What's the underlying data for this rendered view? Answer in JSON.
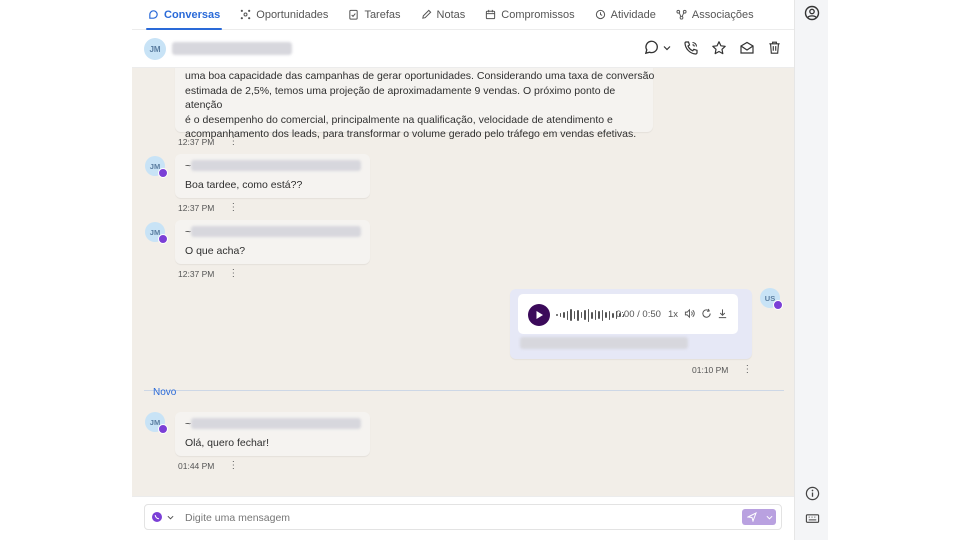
{
  "tabs": [
    {
      "label": "Conversas",
      "icon": "chat-icon",
      "active": true
    },
    {
      "label": "Oportunidades",
      "icon": "network-icon",
      "active": false
    },
    {
      "label": "Tarefas",
      "icon": "clipboard-check-icon",
      "active": false
    },
    {
      "label": "Notas",
      "icon": "pencil-icon",
      "active": false
    },
    {
      "label": "Compromissos",
      "icon": "calendar-icon",
      "active": false
    },
    {
      "label": "Atividade",
      "icon": "clock-icon",
      "active": false
    },
    {
      "label": "Associações",
      "icon": "share-nodes-icon",
      "active": false
    }
  ],
  "header": {
    "avatar_initials": "JM",
    "actions": [
      "chat-bubble-icon",
      "phone-icon",
      "star-icon",
      "mail-icon",
      "trash-icon"
    ]
  },
  "messages": {
    "m1": {
      "lines": [
        "uma boa capacidade das campanhas de gerar oportunidades. Considerando uma taxa de conversão",
        "estimada de 2,5%, temos uma projeção de aproximadamente 9 vendas. O próximo ponto de atenção",
        "é o desempenho do comercial, principalmente na qualificação, velocidade de atendimento e",
        "acompanhamento dos leads, para transformar o volume gerado pelo tráfego em vendas efetivas."
      ],
      "time": "12:37 PM"
    },
    "m2": {
      "avatar": "JM",
      "prefix": "~",
      "text": "Boa tardee, como está??",
      "time": "12:37 PM"
    },
    "m3": {
      "avatar": "JM",
      "prefix": "~",
      "text": "O que acha?",
      "time": "12:37 PM"
    },
    "m4": {
      "avatar": "US",
      "audio_time": "0:00 / 0:50",
      "speed": "1x",
      "time": "01:10 PM"
    },
    "divider_label": "Novo",
    "m5": {
      "avatar": "JM",
      "prefix": "~",
      "text": "Olá, quero fechar!",
      "time": "01:44 PM"
    }
  },
  "composer": {
    "placeholder": "Digite uma mensagem"
  },
  "colors": {
    "accent": "#2a6ad8",
    "whatsapp_badge": "#7b3fd6",
    "play": "#3b0a5a",
    "send": "#b9a1e0"
  }
}
